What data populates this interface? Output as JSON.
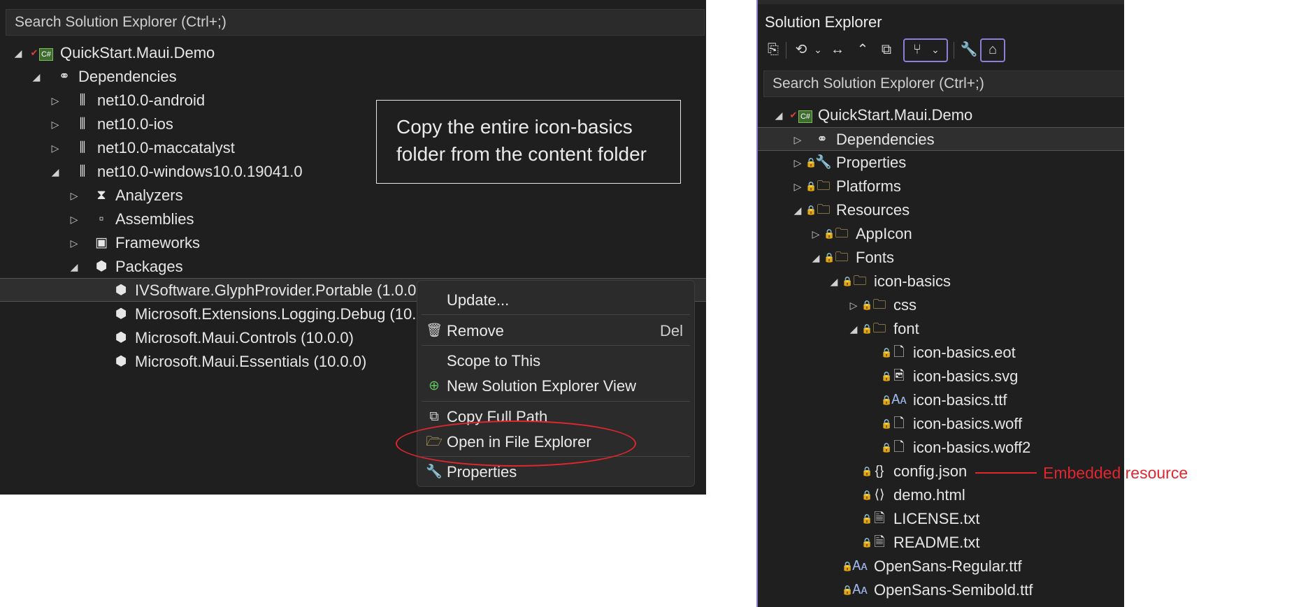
{
  "left": {
    "search_placeholder": "Search Solution Explorer (Ctrl+;)",
    "tree": [
      {
        "label": "QuickStart.Maui.Demo",
        "icon": "csharp-project-icon"
      },
      {
        "label": "Dependencies",
        "icon": "dependencies-icon"
      },
      {
        "label": "net10.0-android",
        "icon": "framework-icon"
      },
      {
        "label": "net10.0-ios",
        "icon": "framework-icon"
      },
      {
        "label": "net10.0-maccatalyst",
        "icon": "framework-icon"
      },
      {
        "label": "net10.0-windows10.0.19041.0",
        "icon": "framework-icon"
      },
      {
        "label": "Analyzers",
        "icon": "analyzer-icon"
      },
      {
        "label": "Assemblies",
        "icon": "assembly-icon"
      },
      {
        "label": "Frameworks",
        "icon": "frameworks-icon"
      },
      {
        "label": "Packages",
        "icon": "nuget-icon"
      },
      {
        "label": "IVSoftware.GlyphProvider.Portable (1.0.0-",
        "icon": "nuget-icon"
      },
      {
        "label": "Microsoft.Extensions.Logging.Debug (10.0",
        "icon": "nuget-icon"
      },
      {
        "label": "Microsoft.Maui.Controls (10.0.0)",
        "icon": "nuget-icon"
      },
      {
        "label": "Microsoft.Maui.Essentials (10.0.0)",
        "icon": "nuget-icon"
      }
    ],
    "callout": "Copy the entire icon-basics folder from the content folder",
    "menu": {
      "update": "Update...",
      "remove": "Remove",
      "remove_shortcut": "Del",
      "scope": "Scope to This",
      "new_view": "New Solution Explorer View",
      "copy_path": "Copy Full Path",
      "open_explorer": "Open in File Explorer",
      "properties": "Properties"
    }
  },
  "right": {
    "title": "Solution Explorer",
    "search_placeholder": "Search Solution Explorer (Ctrl+;)",
    "tree": [
      {
        "label": "QuickStart.Maui.Demo",
        "icon": "csharp-project-icon"
      },
      {
        "label": "Dependencies",
        "icon": "dependencies-icon"
      },
      {
        "label": "Properties",
        "icon": "properties-folder-icon"
      },
      {
        "label": "Platforms",
        "icon": "folder-icon"
      },
      {
        "label": "Resources",
        "icon": "folder-icon"
      },
      {
        "label": "AppIcon",
        "icon": "folder-icon"
      },
      {
        "label": "Fonts",
        "icon": "folder-icon"
      },
      {
        "label": "icon-basics",
        "icon": "folder-icon"
      },
      {
        "label": "css",
        "icon": "folder-icon"
      },
      {
        "label": "font",
        "icon": "folder-icon"
      },
      {
        "label": "icon-basics.eot",
        "icon": "file-icon"
      },
      {
        "label": "icon-basics.svg",
        "icon": "image-file-icon"
      },
      {
        "label": "icon-basics.ttf",
        "icon": "font-file-icon"
      },
      {
        "label": "icon-basics.woff",
        "icon": "file-icon"
      },
      {
        "label": "icon-basics.woff2",
        "icon": "file-icon"
      },
      {
        "label": "config.json",
        "icon": "json-file-icon"
      },
      {
        "label": "demo.html",
        "icon": "html-file-icon"
      },
      {
        "label": "LICENSE.txt",
        "icon": "text-file-icon"
      },
      {
        "label": "README.txt",
        "icon": "text-file-icon"
      },
      {
        "label": "OpenSans-Regular.ttf",
        "icon": "font-file-icon"
      },
      {
        "label": "OpenSans-Semibold.ttf",
        "icon": "font-file-icon"
      }
    ],
    "annotation": "Embedded resource"
  },
  "colors": {
    "panel": "#1f1f1f",
    "accent": "#8c7fd6",
    "annotation": "#e0262f",
    "lock": "#6aa7f0",
    "folder": "#e8c66a"
  }
}
